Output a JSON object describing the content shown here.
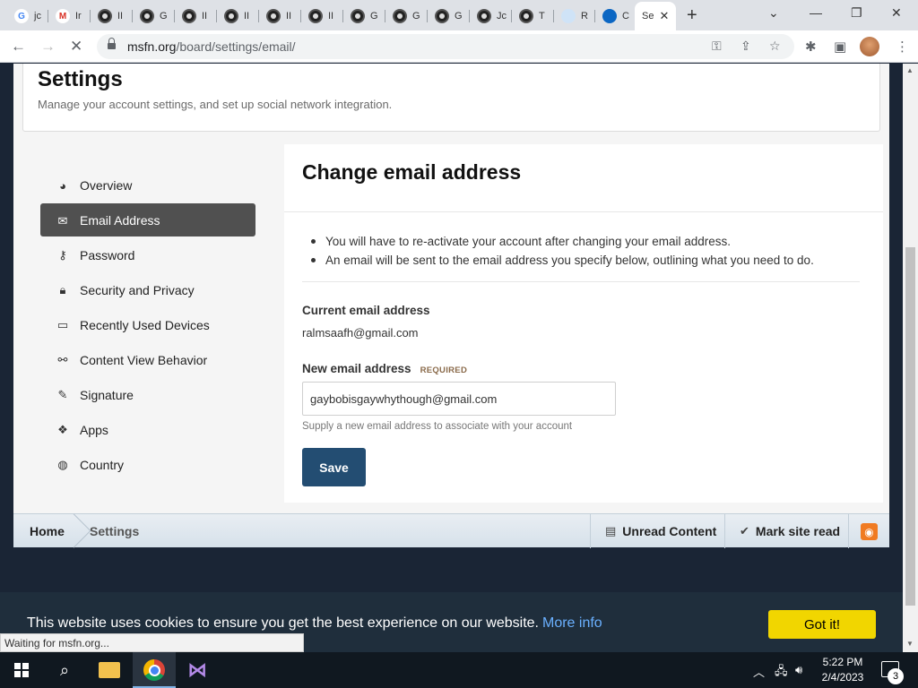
{
  "browser": {
    "tabs": [
      {
        "label": "jc",
        "favicon": "google-g"
      },
      {
        "label": "Ir",
        "favicon": "gmail-m"
      },
      {
        "label": "II",
        "favicon": "msfn"
      },
      {
        "label": "G",
        "favicon": "msfn"
      },
      {
        "label": "II",
        "favicon": "msfn"
      },
      {
        "label": "II",
        "favicon": "msfn"
      },
      {
        "label": "II",
        "favicon": "msfn"
      },
      {
        "label": "II",
        "favicon": "msfn"
      },
      {
        "label": "G",
        "favicon": "msfn"
      },
      {
        "label": "G",
        "favicon": "msfn"
      },
      {
        "label": "G",
        "favicon": "msfn"
      },
      {
        "label": "Jc",
        "favicon": "msfn"
      },
      {
        "label": "T",
        "favicon": "msfn"
      },
      {
        "label": "R",
        "favicon": "reddit"
      },
      {
        "label": "C",
        "favicon": "swirl"
      },
      {
        "label": "Se",
        "favicon": "none",
        "active": true
      }
    ],
    "url_host": "msfn.org",
    "url_path": "/board/settings/email/",
    "status_text": "Waiting for msfn.org..."
  },
  "page": {
    "title": "Settings",
    "subtitle": "Manage your account settings, and set up social network integration."
  },
  "sidebar": {
    "items": [
      {
        "label": "Overview",
        "icon": "dashboard-icon",
        "active": false
      },
      {
        "label": "Email Address",
        "icon": "envelope-icon",
        "active": true
      },
      {
        "label": "Password",
        "icon": "key-icon",
        "active": false
      },
      {
        "label": "Security and Privacy",
        "icon": "lock-icon",
        "active": false
      },
      {
        "label": "Recently Used Devices",
        "icon": "laptop-icon",
        "active": false
      },
      {
        "label": "Content View Behavior",
        "icon": "link-icon",
        "active": false
      },
      {
        "label": "Signature",
        "icon": "pencil-icon",
        "active": false
      },
      {
        "label": "Apps",
        "icon": "cubes-icon",
        "active": false
      },
      {
        "label": "Country",
        "icon": "globe-icon",
        "active": false
      }
    ]
  },
  "content": {
    "title": "Change email address",
    "notes": [
      "You will have to re-activate your account after changing your email address.",
      "An email will be sent to the email address you specify below, outlining what you need to do."
    ],
    "current_label": "Current email address",
    "current_value": "ralmsaafh@gmail.com",
    "new_label": "New email address",
    "required_badge": "REQUIRED",
    "new_value": "gaybobisgaywhythough@gmail.com",
    "help_text": "Supply a new email address to associate with your account",
    "save_label": "Save"
  },
  "footer": {
    "breadcrumb_home": "Home",
    "breadcrumb_current": "Settings",
    "unread_label": "Unread Content",
    "mark_read_label": "Mark site read"
  },
  "cookie": {
    "text": "This website uses cookies to ensure you get the best experience on our website.",
    "link": "More info",
    "button": "Got it!"
  },
  "taskbar": {
    "time": "5:22 PM",
    "date": "2/4/2023",
    "notification_count": "3"
  },
  "colors": {
    "accent": "#234d72",
    "sidebar_active": "#505050",
    "cookie_button": "#f1d600",
    "cookie_link": "#6ab0ff",
    "rss": "#f07b22"
  }
}
